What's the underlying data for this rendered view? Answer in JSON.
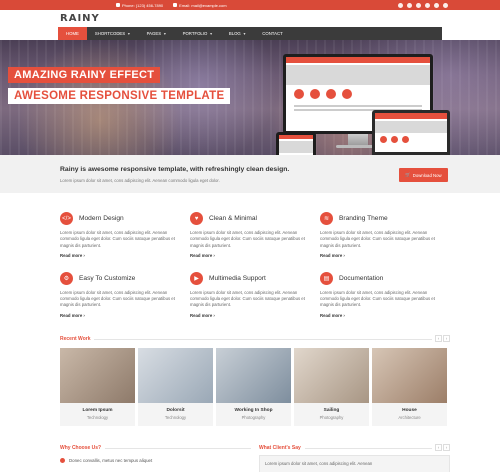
{
  "topbar": {
    "phone": "Phone: (123) 456-7890",
    "email": "Email: mail@example.com",
    "social": [
      "facebook-icon",
      "twitter-icon",
      "rss-icon",
      "linkedin-icon",
      "dribbble-icon",
      "google-plus-icon"
    ]
  },
  "header": {
    "logo": "RAINY"
  },
  "nav": {
    "items": [
      {
        "label": "Home",
        "caret": false
      },
      {
        "label": "Shortcodes",
        "caret": true
      },
      {
        "label": "Pages",
        "caret": true
      },
      {
        "label": "Portfolio",
        "caret": true
      },
      {
        "label": "Blog",
        "caret": true
      },
      {
        "label": "Contact",
        "caret": false
      }
    ],
    "active_index": 0
  },
  "hero": {
    "line1": "Amazing Rainy Effect",
    "line2": "Awesome Responsive Template"
  },
  "tagline": {
    "title": "Rainy is awesome responsive template, with refreshingly clean design.",
    "subtitle": "Lorem ipsum dolor sit amet, cons adipiscing elit. Aenean commodo ligula eget dolor.",
    "button": "Download Now"
  },
  "features": [
    {
      "icon": "code-icon",
      "glyph": "</>",
      "title": "Modern Design",
      "text": "Lorem ipsum dolor sit amet, cons adipiscing elit. Aenean commodo ligula eget dolor. Cum sociis natoque penatibus et magnis dis parturient.",
      "more": "Read more"
    },
    {
      "icon": "heart-icon",
      "glyph": "♥",
      "title": "Clean & Minimal",
      "text": "Lorem ipsum dolor sit amet, cons adipiscing elit. Aenean commodo ligula eget dolor. Cum sociis natoque penatibus et magnis dis parturient.",
      "more": "Read more"
    },
    {
      "icon": "wifi-icon",
      "glyph": "≋",
      "title": "Branding Theme",
      "text": "Lorem ipsum dolor sit amet, cons adipiscing elit. Aenean commodo ligula eget dolor. Cum sociis natoque penatibus et magnis dis parturient.",
      "more": "Read more"
    },
    {
      "icon": "gear-icon",
      "glyph": "⚙",
      "title": "Easy To Customize",
      "text": "Lorem ipsum dolor sit amet, cons adipiscing elit. Aenean commodo ligula eget dolor. Cum sociis natoque penatibus et magnis dis parturient.",
      "more": "Read more"
    },
    {
      "icon": "play-icon",
      "glyph": "▶",
      "title": "Multimedia Support",
      "text": "Lorem ipsum dolor sit amet, cons adipiscing elit. Aenean commodo ligula eget dolor. Cum sociis natoque penatibus et magnis dis parturient.",
      "more": "Read more"
    },
    {
      "icon": "book-icon",
      "glyph": "▤",
      "title": "Documentation",
      "text": "Lorem ipsum dolor sit amet, cons adipiscing elit. Aenean commodo ligula eget dolor. Cum sociis natoque penatibus et magnis dis parturient.",
      "more": "Read more"
    }
  ],
  "recent_work": {
    "title": "Recent Work",
    "items": [
      {
        "title": "Lorem Ipsum",
        "category": "Technology",
        "color1": "#c9b8a8",
        "color2": "#8e7a6a"
      },
      {
        "title": "Dolorsit",
        "category": "Technology",
        "color1": "#d8dde3",
        "color2": "#9aa8b6"
      },
      {
        "title": "Working In Shop",
        "category": "Photography",
        "color1": "#c8cfd6",
        "color2": "#7e8e9e"
      },
      {
        "title": "Sailing",
        "category": "Photography",
        "color1": "#e1d7cc",
        "color2": "#a89684"
      },
      {
        "title": "House",
        "category": "Architecture",
        "color1": "#d7c6b6",
        "color2": "#9c7e68"
      }
    ]
  },
  "why_choose": {
    "title": "Why Choose Us?",
    "item1": "Donec convallis, metus nec tempus aliquet"
  },
  "clients": {
    "title": "What Client's Say",
    "quote": "Lorem ipsum dolor sit amet, cons adipiscing elit. Aenean"
  },
  "colors": {
    "accent": "#e5503d",
    "nav_bg": "#3b3b3b",
    "tagline_bg": "#f1f1f1"
  }
}
